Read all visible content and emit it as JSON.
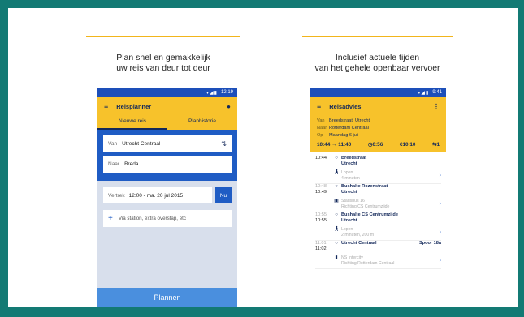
{
  "left_panel": {
    "headline_line1": "Plan snel en gemakkelijk",
    "headline_line2": "uw reis van deur tot deur",
    "status_time": "12:19",
    "appbar": {
      "menu_icon": "menu-icon",
      "title": "Reisplanner",
      "mic_icon": "mic-icon"
    },
    "tabs": [
      "Nieuwe reis",
      "Planhistorie"
    ],
    "from_label": "Van",
    "from_value": "Utrecht Centraal",
    "to_label": "Naar",
    "to_value": "Breda",
    "depart_label": "Vertrek",
    "depart_value": "12:00 - ma. 20 jul 2015",
    "now_button": "Nu",
    "via_placeholder": "Via station, extra overstap, etc",
    "plan_button": "Plannen"
  },
  "right_panel": {
    "headline_line1": "Inclusief actuele tijden",
    "headline_line2": "van het gehele openbaar vervoer",
    "status_time": "9:41",
    "appbar": {
      "menu_icon": "menu-icon",
      "title": "Reisadvies",
      "more_icon": "more-vert-icon"
    },
    "from_label": "Van",
    "from_value": "Breedstraat, Utrecht",
    "to_label": "Naar",
    "to_value": "Rotterdam Centraal",
    "date_label": "Op",
    "date_value": "Maandag 6 juli",
    "summary": {
      "times": "10:44 → 11:40",
      "duration": "0:56",
      "price": "€10,10",
      "transfers": "1"
    },
    "steps": [
      {
        "time": "10:44",
        "place": "Breedstraat",
        "place2": "Utrecht"
      },
      {
        "mode_icon": "walk-icon",
        "mode": "Lopen",
        "detail": "4 minuten"
      },
      {
        "time_muted": "10:48",
        "time": "10:49",
        "place": "Bushalte Rozenstraat",
        "place2": "Utrecht"
      },
      {
        "mode_icon": "bus-icon",
        "mode": "Stadsbus 16",
        "detail": "Richting CS Centrumzijde"
      },
      {
        "time_muted": "10:55",
        "time": "10:55",
        "place": "Bushalte CS Centrumzijde",
        "place2": "Utrecht"
      },
      {
        "mode_icon": "walk-icon",
        "mode": "Lopen",
        "detail": "2 minuten, 200 m"
      },
      {
        "time_muted": "11:01",
        "time": "11:02",
        "place": "Utrecht Centraal",
        "right": "Spoor 18a"
      },
      {
        "mode_icon": "train-icon",
        "mode": "NS Intercity",
        "detail": "Richting Rotterdam Centraal"
      }
    ]
  }
}
